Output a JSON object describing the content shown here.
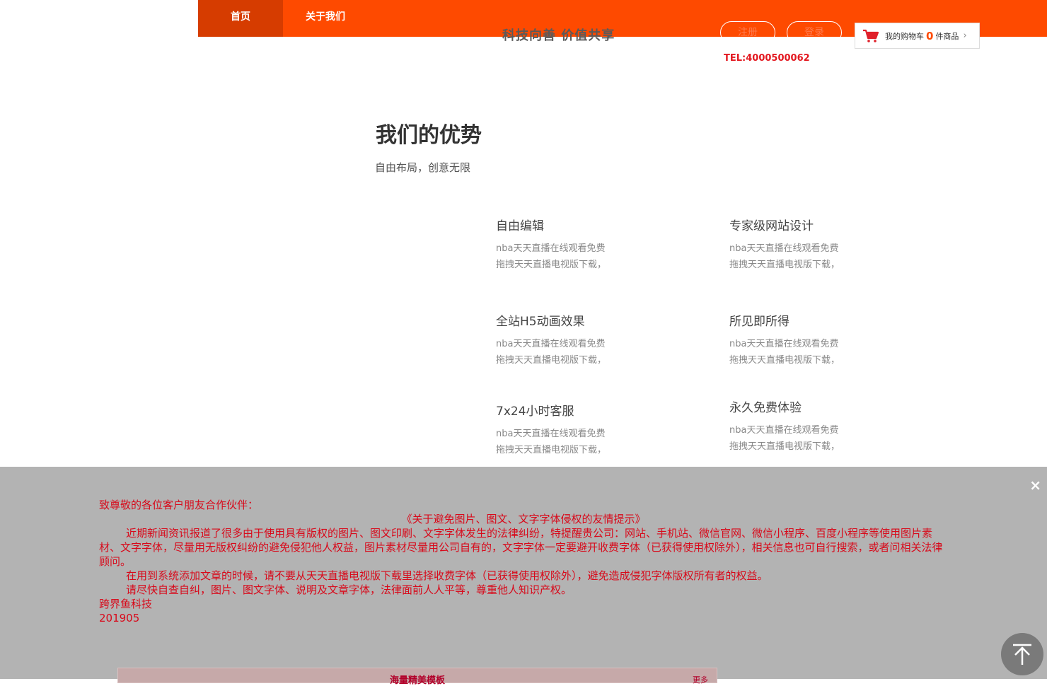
{
  "nav": {
    "items": [
      "首页",
      "关于我们"
    ]
  },
  "header": {
    "slogan": "科技向善 价值共享",
    "register_label": "注册",
    "login_label": "登录",
    "tel": "TEL:4000500062",
    "cart": {
      "prefix": "我的购物车",
      "count": "0",
      "suffix": "件商品"
    }
  },
  "advantages": {
    "title": "我们的优势",
    "subtitle": "自由布局，创意无限",
    "features": [
      {
        "title": "自由编辑",
        "line1": "nba天天直播在线观看免费",
        "line2": "拖拽天天直播电视版下载，"
      },
      {
        "title": "专家级网站设计",
        "line1": "nba天天直播在线观看免费",
        "line2": "拖拽天天直播电视版下载，"
      },
      {
        "title": "全站H5动画效果",
        "line1": "nba天天直播在线观看免费",
        "line2": "拖拽天天直播电视版下载，"
      },
      {
        "title": "所见即所得",
        "line1": "nba天天直播在线观看免费",
        "line2": "拖拽天天直播电视版下载，"
      },
      {
        "title": "7x24小时客服",
        "line1": "nba天天直播在线观看免费",
        "line2": "拖拽天天直播电视版下载，"
      },
      {
        "title": "永久免费体验",
        "line1": "nba天天直播在线观看免费",
        "line2": "拖拽天天直播电视版下载，"
      }
    ]
  },
  "notice": {
    "greeting": "致尊敬的各位客户朋友合作伙伴：",
    "heading": "《关于避免图片、图文、文字字体侵权的友情提示》",
    "para1": "近期新闻资讯报道了很多由于使用具有版权的图片、图文印刷、文字字体发生的法律纠纷，特提醒贵公司：网站、手机站、微信官网、微信小程序、百度小程序等使用图片素材、文字字体，尽量用无版权纠纷的避免侵犯他人权益，图片素材尽量用公司自有的，文字字体一定要避开收费字体（已获得使用权除外），相关信息也可自行搜索，或者问相关法律顾问。",
    "para2": "在用到系统添加文章的时候，请不要从天天直播电视版下载里选择收费字体（已获得使用权除外），避免造成侵犯字体版权所有者的权益。",
    "para3": "请尽快自查自纠，图片、图文字体、说明及文章字体，法律面前人人平等，尊重他人知识产权。",
    "company": "跨界鱼科技",
    "date": "201905",
    "close_label": "×"
  },
  "bottom_box": {
    "title": "海量精美模板",
    "more": "更多"
  },
  "colors": {
    "brand": "#fe4a00",
    "notice_text": "#d8091a",
    "overlay": "#b3b3b3"
  },
  "icons": {
    "cart": "cart-icon",
    "to_top": "arrow-up-icon",
    "close": "close-icon"
  }
}
